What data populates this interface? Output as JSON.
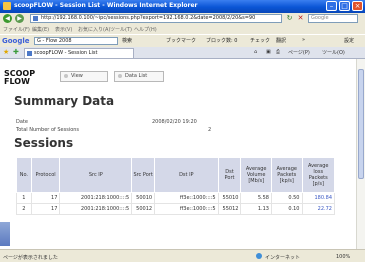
{
  "window": {
    "title": "scoopFLOW - Session List - Windows Internet Explorer"
  },
  "address_bar": {
    "url": "http://192.168.0.100/~ipc/sessions.php?export=192.168.0.2&date=2008/2/20&s=90",
    "search_placeholder": "Google"
  },
  "menu": {
    "items": [
      "ファイル(F)",
      "編集(E)",
      "表示(V)",
      "お気に入り(A)",
      "ツール(T)",
      "ヘルプ(H)"
    ]
  },
  "google_toolbar": {
    "logo": "Google",
    "search_value": "G - Flow 2008",
    "items": [
      "検索",
      "ブックマーク",
      "ブロック数: 0",
      "チェック",
      "翻訳",
      "»"
    ],
    "settings_label": "設定"
  },
  "tabbar": {
    "tab_label": "scoopFLOW - Session List",
    "tools": [
      "ページ(P)",
      "ツール(O)"
    ]
  },
  "page": {
    "logo_line1": "SCOOP",
    "logo_line2": "FLOW",
    "view_button": "View",
    "datalist_button": "Data List",
    "summary_title": "Summary Data",
    "date_label": "Date",
    "date_value": "2008/02/20 19:20",
    "sessions_label": "Total Number of Sessions",
    "sessions_value": "2",
    "sessions_title": "Sessions",
    "table": {
      "headers": [
        "No.",
        "Protocol",
        "Src IP",
        "Src Port",
        "Dst IP",
        "Dst Port",
        "Average Volume [Mb/s]",
        "Average Packets [kp/s]",
        "Average loss Packets [p/s]"
      ],
      "rows": [
        [
          "1",
          "17",
          "2001:218:1000::::5",
          "50010",
          "ff3e::1000::::5",
          "55010",
          "5.58",
          "0.50",
          "180.84"
        ],
        [
          "2",
          "17",
          "2001:218:1000::::5",
          "50012",
          "ff3e::1000::::5",
          "55012",
          "1.13",
          "0.10",
          "22.72"
        ]
      ]
    }
  },
  "statusbar": {
    "left": "ページが表示されました",
    "zone": "インターネット",
    "zoom": "100%"
  }
}
